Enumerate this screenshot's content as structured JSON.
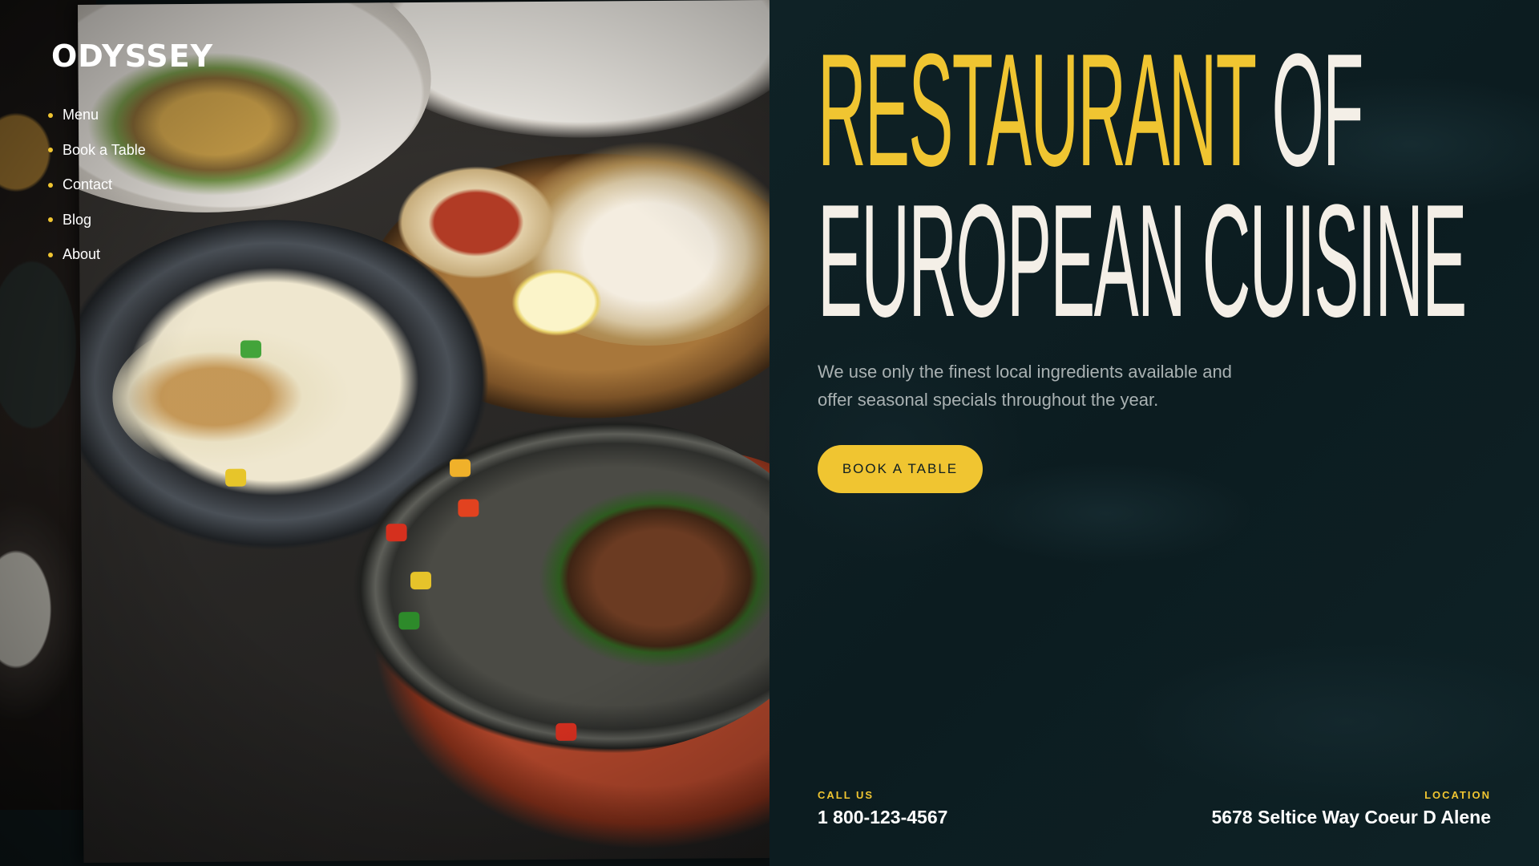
{
  "brand": {
    "logo": "ODYSSEY"
  },
  "nav": {
    "items": [
      {
        "label": "Menu"
      },
      {
        "label": "Book a Table"
      },
      {
        "label": "Contact"
      },
      {
        "label": "Blog"
      },
      {
        "label": "About"
      }
    ]
  },
  "hero": {
    "headline_accent": "RESTAURANT",
    "headline_rest_line1": " OF",
    "headline_line2": "EUROPEAN CUISINE",
    "description": "We use only the finest local ingredients available and offer seasonal specials throughout the year.",
    "cta_label": "BOOK A TABLE"
  },
  "contact": {
    "call_label": "CALL US",
    "phone": "1 800-123-4567",
    "location_label": "LOCATION",
    "address": "5678  Seltice Way Coeur D Alene"
  },
  "colors": {
    "accent": "#f0c531",
    "background": "#0e1e22",
    "headline_light": "#f4efe7"
  },
  "image": {
    "subject": "food-photo"
  }
}
